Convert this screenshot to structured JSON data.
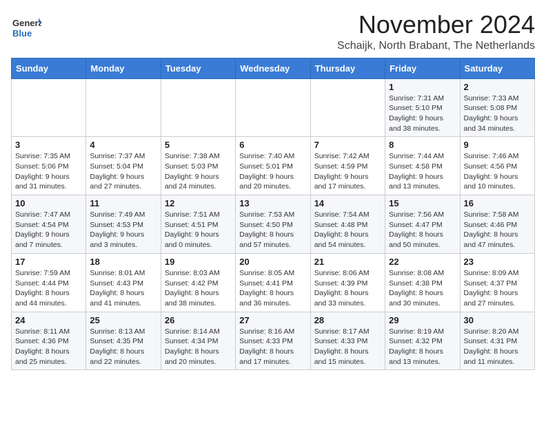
{
  "logo": {
    "general": "General",
    "blue": "Blue"
  },
  "title": "November 2024",
  "subtitle": "Schaijk, North Brabant, The Netherlands",
  "days_header": [
    "Sunday",
    "Monday",
    "Tuesday",
    "Wednesday",
    "Thursday",
    "Friday",
    "Saturday"
  ],
  "weeks": [
    [
      {
        "day": "",
        "info": ""
      },
      {
        "day": "",
        "info": ""
      },
      {
        "day": "",
        "info": ""
      },
      {
        "day": "",
        "info": ""
      },
      {
        "day": "",
        "info": ""
      },
      {
        "day": "1",
        "info": "Sunrise: 7:31 AM\nSunset: 5:10 PM\nDaylight: 9 hours and 38 minutes."
      },
      {
        "day": "2",
        "info": "Sunrise: 7:33 AM\nSunset: 5:08 PM\nDaylight: 9 hours and 34 minutes."
      }
    ],
    [
      {
        "day": "3",
        "info": "Sunrise: 7:35 AM\nSunset: 5:06 PM\nDaylight: 9 hours and 31 minutes."
      },
      {
        "day": "4",
        "info": "Sunrise: 7:37 AM\nSunset: 5:04 PM\nDaylight: 9 hours and 27 minutes."
      },
      {
        "day": "5",
        "info": "Sunrise: 7:38 AM\nSunset: 5:03 PM\nDaylight: 9 hours and 24 minutes."
      },
      {
        "day": "6",
        "info": "Sunrise: 7:40 AM\nSunset: 5:01 PM\nDaylight: 9 hours and 20 minutes."
      },
      {
        "day": "7",
        "info": "Sunrise: 7:42 AM\nSunset: 4:59 PM\nDaylight: 9 hours and 17 minutes."
      },
      {
        "day": "8",
        "info": "Sunrise: 7:44 AM\nSunset: 4:58 PM\nDaylight: 9 hours and 13 minutes."
      },
      {
        "day": "9",
        "info": "Sunrise: 7:46 AM\nSunset: 4:56 PM\nDaylight: 9 hours and 10 minutes."
      }
    ],
    [
      {
        "day": "10",
        "info": "Sunrise: 7:47 AM\nSunset: 4:54 PM\nDaylight: 9 hours and 7 minutes."
      },
      {
        "day": "11",
        "info": "Sunrise: 7:49 AM\nSunset: 4:53 PM\nDaylight: 9 hours and 3 minutes."
      },
      {
        "day": "12",
        "info": "Sunrise: 7:51 AM\nSunset: 4:51 PM\nDaylight: 9 hours and 0 minutes."
      },
      {
        "day": "13",
        "info": "Sunrise: 7:53 AM\nSunset: 4:50 PM\nDaylight: 8 hours and 57 minutes."
      },
      {
        "day": "14",
        "info": "Sunrise: 7:54 AM\nSunset: 4:48 PM\nDaylight: 8 hours and 54 minutes."
      },
      {
        "day": "15",
        "info": "Sunrise: 7:56 AM\nSunset: 4:47 PM\nDaylight: 8 hours and 50 minutes."
      },
      {
        "day": "16",
        "info": "Sunrise: 7:58 AM\nSunset: 4:46 PM\nDaylight: 8 hours and 47 minutes."
      }
    ],
    [
      {
        "day": "17",
        "info": "Sunrise: 7:59 AM\nSunset: 4:44 PM\nDaylight: 8 hours and 44 minutes."
      },
      {
        "day": "18",
        "info": "Sunrise: 8:01 AM\nSunset: 4:43 PM\nDaylight: 8 hours and 41 minutes."
      },
      {
        "day": "19",
        "info": "Sunrise: 8:03 AM\nSunset: 4:42 PM\nDaylight: 8 hours and 38 minutes."
      },
      {
        "day": "20",
        "info": "Sunrise: 8:05 AM\nSunset: 4:41 PM\nDaylight: 8 hours and 36 minutes."
      },
      {
        "day": "21",
        "info": "Sunrise: 8:06 AM\nSunset: 4:39 PM\nDaylight: 8 hours and 33 minutes."
      },
      {
        "day": "22",
        "info": "Sunrise: 8:08 AM\nSunset: 4:38 PM\nDaylight: 8 hours and 30 minutes."
      },
      {
        "day": "23",
        "info": "Sunrise: 8:09 AM\nSunset: 4:37 PM\nDaylight: 8 hours and 27 minutes."
      }
    ],
    [
      {
        "day": "24",
        "info": "Sunrise: 8:11 AM\nSunset: 4:36 PM\nDaylight: 8 hours and 25 minutes."
      },
      {
        "day": "25",
        "info": "Sunrise: 8:13 AM\nSunset: 4:35 PM\nDaylight: 8 hours and 22 minutes."
      },
      {
        "day": "26",
        "info": "Sunrise: 8:14 AM\nSunset: 4:34 PM\nDaylight: 8 hours and 20 minutes."
      },
      {
        "day": "27",
        "info": "Sunrise: 8:16 AM\nSunset: 4:33 PM\nDaylight: 8 hours and 17 minutes."
      },
      {
        "day": "28",
        "info": "Sunrise: 8:17 AM\nSunset: 4:33 PM\nDaylight: 8 hours and 15 minutes."
      },
      {
        "day": "29",
        "info": "Sunrise: 8:19 AM\nSunset: 4:32 PM\nDaylight: 8 hours and 13 minutes."
      },
      {
        "day": "30",
        "info": "Sunrise: 8:20 AM\nSunset: 4:31 PM\nDaylight: 8 hours and 11 minutes."
      }
    ]
  ]
}
